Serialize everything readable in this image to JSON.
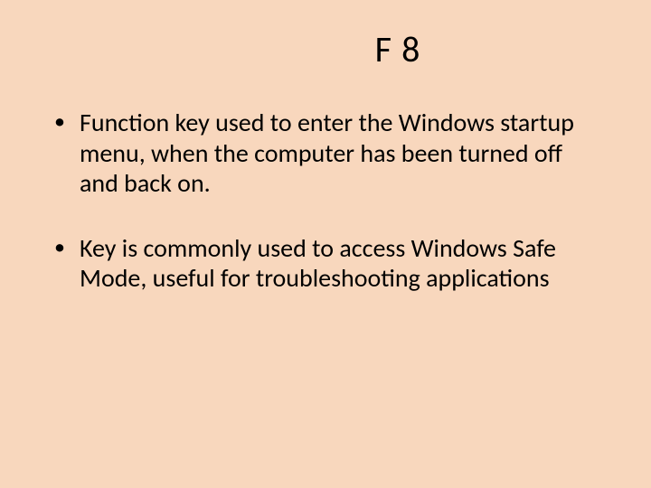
{
  "slide": {
    "title": "F 8",
    "bullets": [
      "Function key used to enter the Windows startup menu, when the computer has been turned off and back on.",
      "Key is commonly used to access Windows Safe Mode, useful for troubleshooting applications"
    ]
  }
}
